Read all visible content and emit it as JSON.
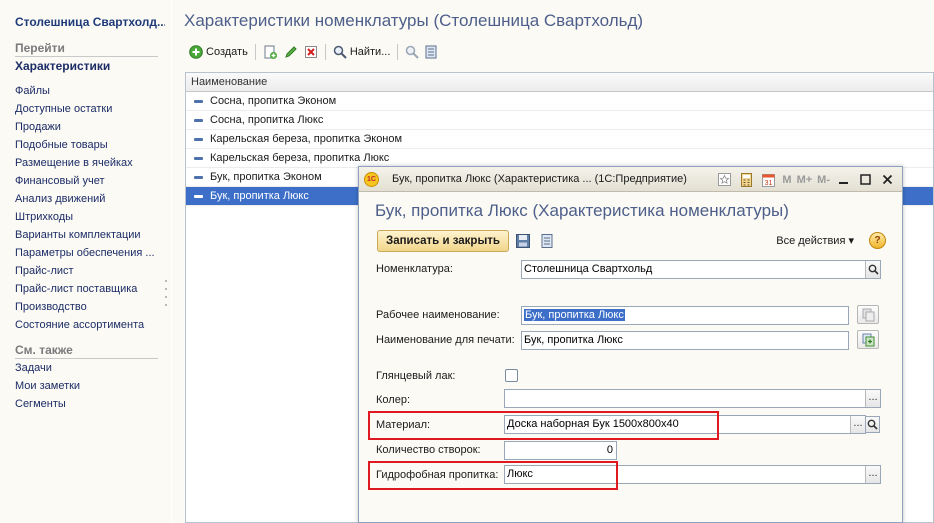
{
  "left_panel": {
    "title": "Столешница Свартхолд...",
    "goto_header": "Перейти",
    "current_item": "Характеристики",
    "nav_items": [
      "Файлы",
      "Доступные остатки",
      "Продажи",
      "Подобные товары",
      "Размещение в ячейках",
      "Финансовый учет",
      "Анализ движений",
      "Штрихкоды",
      "Варианты комплектации",
      "Параметры обеспечения ...",
      "Прайс-лист",
      "Прайс-лист поставщика",
      "Производство",
      "Состояние ассортимента"
    ],
    "see_also_header": "См. также",
    "see_also_items": [
      "Задачи",
      "Мои заметки",
      "Сегменты"
    ]
  },
  "main": {
    "title": "Характеристики номенклатуры (Столешница Свартхольд)",
    "toolbar": {
      "create_label": "Создать",
      "find_label": "Найти..."
    },
    "list_header": "Наименование",
    "rows": [
      "Сосна, пропитка Эконом",
      "Сосна, пропитка Люкс",
      "Карельская береза, пропитка Эконом",
      "Карельская береза, пропитка Люкс",
      "Бук, пропитка Эконом",
      "Бук, пропитка Люкс"
    ],
    "selected_row_index": 5
  },
  "dialog": {
    "logo_text": "1С",
    "caption": "Бук, пропитка Люкс (Характеристика ... (1С:Предприятие)",
    "title_buttons": {
      "m": "M",
      "m_plus": "M+",
      "m_minus": "M-"
    },
    "title": "Бук, пропитка Люкс (Характеристика номенклатуры)",
    "save_close_label": "Записать и закрыть",
    "all_actions_label": "Все действия ▾",
    "help_label": "?",
    "fields": {
      "nomenclature": {
        "label": "Номенклатура:",
        "value": "Столешница Свартхольд"
      },
      "work_name": {
        "label": "Рабочее наименование:",
        "value": "Бук, пропитка Люкс"
      },
      "print_name": {
        "label": "Наименование для печати:",
        "value": "Бук, пропитка Люкс"
      },
      "gloss": {
        "label": "Глянцевый лак:",
        "checked": false
      },
      "color": {
        "label": "Колер:",
        "value": ""
      },
      "material": {
        "label": "Материал:",
        "value": "Доска наборная Бук 1500x800x40"
      },
      "door_count": {
        "label": "Количество створок:",
        "value": "0"
      },
      "impregnation": {
        "label": "Гидрофобная пропитка:",
        "value": "Люкс"
      }
    },
    "choose_button_label": "...",
    "search_icon": "magnifier-icon"
  },
  "colors": {
    "accent_blue": "#3d6fc9",
    "title_color": "#4d5f8a",
    "highlight_red": "#e0181f",
    "button_gold": "#f1d58a"
  }
}
